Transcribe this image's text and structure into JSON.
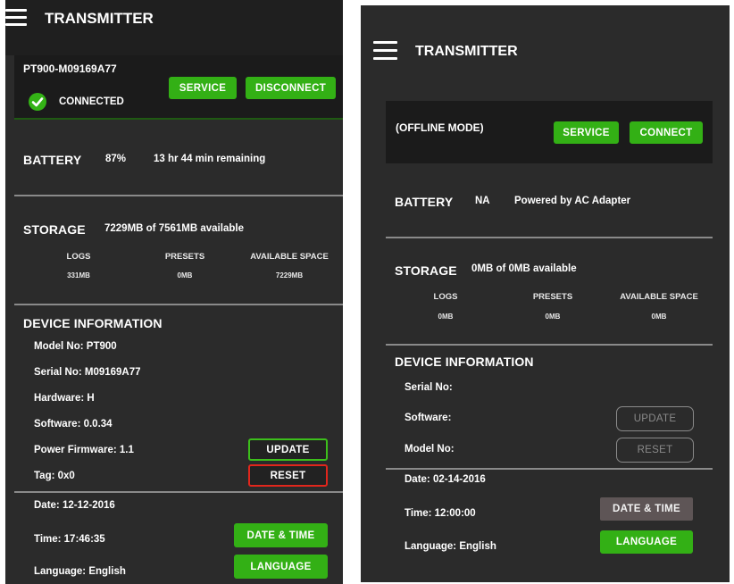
{
  "left": {
    "header": {
      "title": "TRANSMITTER"
    },
    "device": {
      "id": "PT900-M09169A77",
      "status": "CONNECTED",
      "service_label": "SERVICE",
      "disconnect_label": "DISCONNECT"
    },
    "battery": {
      "title": "BATTERY",
      "percent": "87%",
      "remaining": "13 hr 44 min remaining"
    },
    "storage": {
      "title": "STORAGE",
      "summary": "7229MB of 7561MB available",
      "columns": [
        {
          "label": "LOGS",
          "value": "331MB"
        },
        {
          "label": "PRESETS",
          "value": "0MB"
        },
        {
          "label": "AVAILABLE SPACE",
          "value": "7229MB"
        }
      ]
    },
    "device_info": {
      "title": "DEVICE INFORMATION",
      "model": "Model No: PT900",
      "serial": "Serial No: M09169A77",
      "hardware": "Hardware: H",
      "software": "Software: 0.0.34",
      "power_firmware": "Power Firmware: 1.1",
      "tag": "Tag: 0x0",
      "update_label": "UPDATE",
      "reset_label": "RESET"
    },
    "datetime": {
      "date": "Date: 12-12-2016",
      "time": "Time: 17:46:35",
      "language": "Language: English",
      "date_time_label": "DATE & TIME",
      "language_label": "LANGUAGE"
    }
  },
  "right": {
    "header": {
      "title": "TRANSMITTER"
    },
    "device": {
      "mode": "(OFFLINE MODE)",
      "service_label": "SERVICE",
      "connect_label": "CONNECT"
    },
    "battery": {
      "title": "BATTERY",
      "percent": "NA",
      "remaining": "Powered by AC Adapter"
    },
    "storage": {
      "title": "STORAGE",
      "summary": "0MB of 0MB available",
      "columns": [
        {
          "label": "LOGS",
          "value": "0MB"
        },
        {
          "label": "PRESETS",
          "value": "0MB"
        },
        {
          "label": "AVAILABLE SPACE",
          "value": "0MB"
        }
      ]
    },
    "device_info": {
      "title": "DEVICE INFORMATION",
      "serial": "Serial No:",
      "software": "Software:",
      "model": "Model No:",
      "update_label": "UPDATE",
      "reset_label": "RESET"
    },
    "datetime": {
      "date": "Date: 02-14-2016",
      "time": "Time: 12:00:00",
      "language": "Language: English",
      "date_time_label": "DATE & TIME",
      "language_label": "LANGUAGE"
    }
  },
  "colors": {
    "panel_bg": "#2b2b2b",
    "header_bg": "#1e1e1e",
    "accent_green": "#33b015",
    "reset_red": "#e1261c",
    "divider": "#8a8a8a"
  },
  "icons": {
    "menu": "hamburger-menu-icon",
    "connected": "check-circle-icon"
  }
}
